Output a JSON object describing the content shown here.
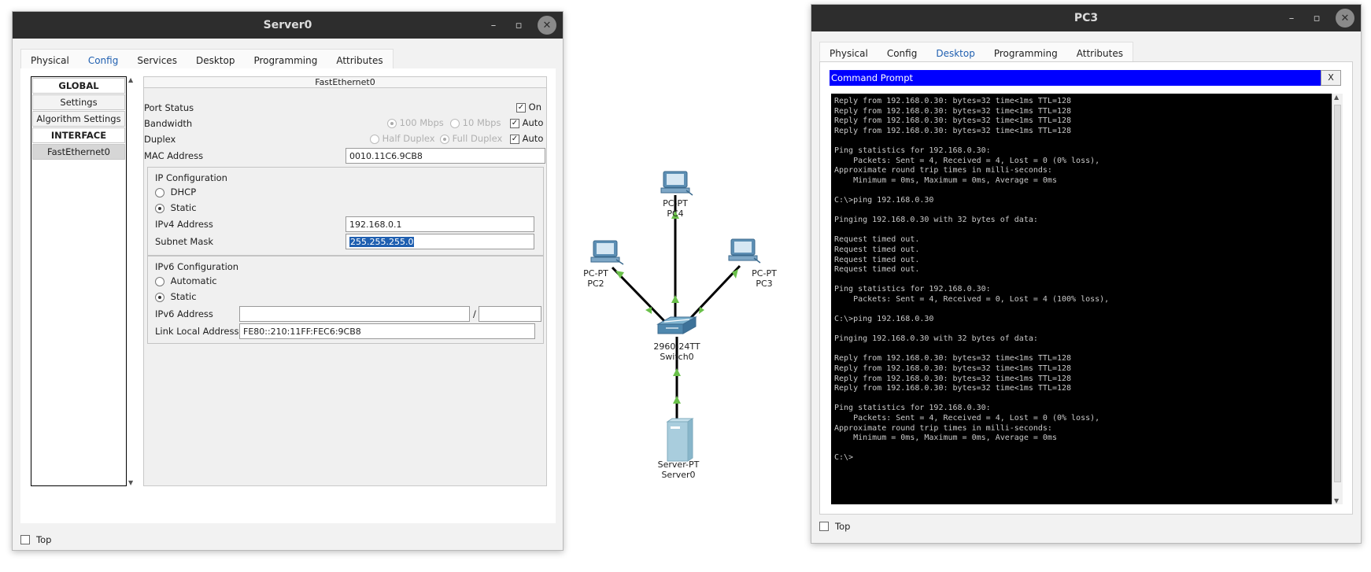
{
  "server_window": {
    "title": "Server0",
    "tabs": [
      {
        "label": "Physical"
      },
      {
        "label": "Config"
      },
      {
        "label": "Services"
      },
      {
        "label": "Desktop"
      },
      {
        "label": "Programming"
      },
      {
        "label": "Attributes"
      }
    ],
    "active_tab": "Config",
    "sidebar": {
      "items": [
        {
          "label": "GLOBAL"
        },
        {
          "label": "Settings"
        },
        {
          "label": "Algorithm Settings"
        },
        {
          "label": "INTERFACE"
        },
        {
          "label": "FastEthernet0"
        }
      ]
    },
    "interface": {
      "header": "FastEthernet0",
      "port_status_label": "Port Status",
      "port_status_on_label": "On",
      "bandwidth_label": "Bandwidth",
      "bw_100": "100 Mbps",
      "bw_10": "10 Mbps",
      "auto_label": "Auto",
      "duplex_label": "Duplex",
      "half_duplex": "Half Duplex",
      "full_duplex": "Full Duplex",
      "mac_label": "MAC Address",
      "mac_value": "0010.11C6.9CB8",
      "ip_config_label": "IP Configuration",
      "dhcp_label": "DHCP",
      "static_label": "Static",
      "ipv4_label": "IPv4 Address",
      "ipv4_value": "192.168.0.1",
      "subnet_label": "Subnet Mask",
      "subnet_value": "255.255.255.0",
      "ipv6_config_label": "IPv6 Configuration",
      "automatic_label": "Automatic",
      "ipv6_static_label": "Static",
      "ipv6_address_label": "IPv6 Address",
      "ipv6_address_value": "",
      "ipv6_prefix_value": "",
      "ipv6_slash": "/",
      "link_local_label": "Link Local Address:",
      "link_local_value": "FE80::210:11FF:FEC6:9CB8"
    },
    "top_label": "Top"
  },
  "topology": {
    "nodes": [
      {
        "id": "pc4",
        "type_label": "PC-PT",
        "name": "PC4"
      },
      {
        "id": "pc2",
        "type_label": "PC-PT",
        "name": "PC2"
      },
      {
        "id": "pc3",
        "type_label": "PC-PT",
        "name": "PC3"
      },
      {
        "id": "switch0",
        "type_label": "2960-24TT",
        "name": "Switch0"
      },
      {
        "id": "server0",
        "type_label": "Server-PT",
        "name": "Server0"
      }
    ],
    "link_color": "#000000",
    "link_up_color": "#6ac04a"
  },
  "pc3_window": {
    "title": "PC3",
    "tabs": [
      {
        "label": "Physical"
      },
      {
        "label": "Config"
      },
      {
        "label": "Desktop"
      },
      {
        "label": "Programming"
      },
      {
        "label": "Attributes"
      }
    ],
    "active_tab": "Desktop",
    "cmd_title": "Command Prompt",
    "cmd_close": "X",
    "console_text": "Reply from 192.168.0.30: bytes=32 time<1ms TTL=128\nReply from 192.168.0.30: bytes=32 time<1ms TTL=128\nReply from 192.168.0.30: bytes=32 time<1ms TTL=128\nReply from 192.168.0.30: bytes=32 time<1ms TTL=128\n\nPing statistics for 192.168.0.30:\n    Packets: Sent = 4, Received = 4, Lost = 0 (0% loss),\nApproximate round trip times in milli-seconds:\n    Minimum = 0ms, Maximum = 0ms, Average = 0ms\n\nC:\\>ping 192.168.0.30\n\nPinging 192.168.0.30 with 32 bytes of data:\n\nRequest timed out.\nRequest timed out.\nRequest timed out.\nRequest timed out.\n\nPing statistics for 192.168.0.30:\n    Packets: Sent = 4, Received = 0, Lost = 4 (100% loss),\n\nC:\\>ping 192.168.0.30\n\nPinging 192.168.0.30 with 32 bytes of data:\n\nReply from 192.168.0.30: bytes=32 time<1ms TTL=128\nReply from 192.168.0.30: bytes=32 time<1ms TTL=128\nReply from 192.168.0.30: bytes=32 time<1ms TTL=128\nReply from 192.168.0.30: bytes=32 time<1ms TTL=128\n\nPing statistics for 192.168.0.30:\n    Packets: Sent = 4, Received = 4, Lost = 0 (0% loss),\nApproximate round trip times in milli-seconds:\n    Minimum = 0ms, Maximum = 0ms, Average = 0ms\n\nC:\\>",
    "top_label": "Top"
  }
}
